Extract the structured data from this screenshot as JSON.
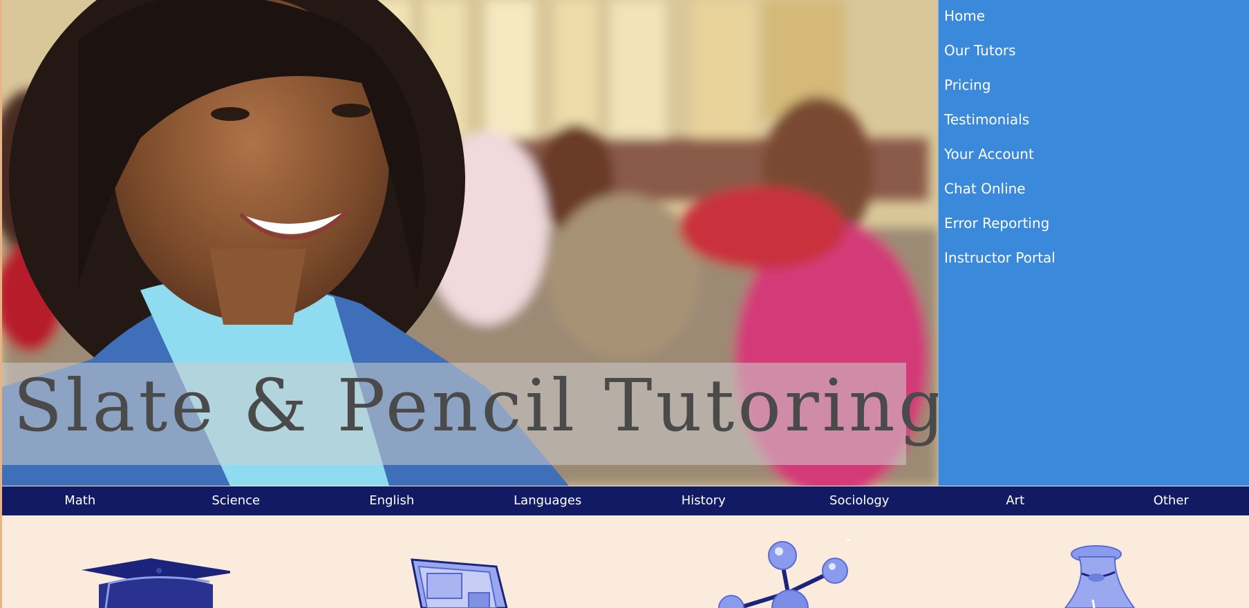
{
  "hero": {
    "title": "Slate & Pencil Tutoring"
  },
  "sidenav": {
    "items": [
      {
        "label": "Home"
      },
      {
        "label": "Our Tutors"
      },
      {
        "label": "Pricing"
      },
      {
        "label": "Testimonials"
      },
      {
        "label": "Your Account"
      },
      {
        "label": "Chat Online"
      },
      {
        "label": "Error Reporting"
      },
      {
        "label": "Instructor Portal"
      }
    ]
  },
  "subjects": {
    "items": [
      {
        "label": "Math"
      },
      {
        "label": "Science"
      },
      {
        "label": "English"
      },
      {
        "label": "Languages"
      },
      {
        "label": "History"
      },
      {
        "label": "Sociology"
      },
      {
        "label": "Art"
      },
      {
        "label": "Other"
      }
    ]
  },
  "features": {
    "icons": [
      "graduation-cap-icon",
      "computer-monitor-icon",
      "molecule-icon",
      "money-bag-icon"
    ]
  },
  "colors": {
    "sidenav_bg": "#3b89db",
    "subjectbar_bg": "#121a64",
    "page_bg": "#faebdc",
    "icon_blue": "#7b8de6",
    "icon_navy": "#1b237a"
  }
}
